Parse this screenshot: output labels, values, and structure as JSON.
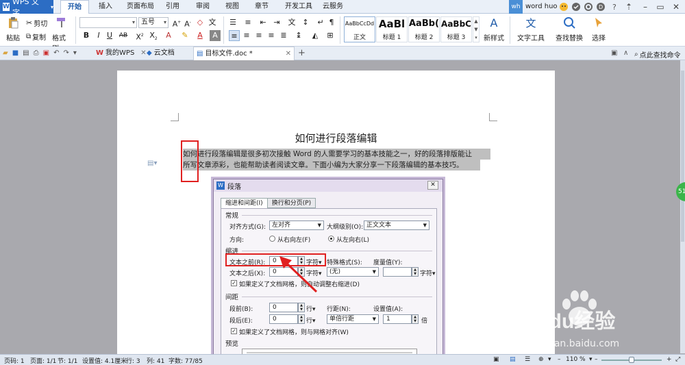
{
  "titlebar": {
    "app_button": "WPS 文字",
    "tabs": [
      "开始",
      "插入",
      "页面布局",
      "引用",
      "审阅",
      "视图",
      "章节",
      "开发工具",
      "云服务"
    ],
    "active_tab": "开始",
    "user_initials": "wh",
    "username": "word huo"
  },
  "ribbon": {
    "paste": "粘贴",
    "cut": "剪切",
    "copy": "复制",
    "format_painter": "格式刷",
    "font_size": "五号",
    "styles": [
      {
        "sample": "AaBbCcDd",
        "name": "正文"
      },
      {
        "sample": "AaBl",
        "name": "标题 1"
      },
      {
        "sample": "AaBb(",
        "name": "标题 2"
      },
      {
        "sample": "AaBbC",
        "name": "标题 3"
      }
    ],
    "new_style": "新样式",
    "text_tools": "文字工具",
    "find_replace": "查找替换",
    "select": "选择"
  },
  "tabs_bar": {
    "tab_mywps": "我的WPS",
    "tab_cloud": "云文档",
    "tab_doc": "目标文件.doc *",
    "search_hint": "点此查找命令"
  },
  "document": {
    "title": "如何进行段落编辑",
    "line1": "如何进行段落编辑是很多初次接触 Word 的人需要学习的基本技能之一，好的段落排版能让",
    "line2": "所写文章添彩，也能帮助读者阅读文章。下面小编为大家分享一下段落编辑的基本技巧。"
  },
  "dialog": {
    "title": "段落",
    "tab_indent": "缩进和间距(I)",
    "tab_breaks": "换行和分页(P)",
    "general": "常规",
    "align_label": "对齐方式(G):",
    "align_value": "左对齐",
    "outline_label": "大纲级别(O):",
    "outline_value": "正文文本",
    "direction_label": "方向:",
    "rtl": "从右向左(F)",
    "ltr": "从左向右(L)",
    "indent": "缩进",
    "before_text_label": "文本之前(R):",
    "before_text_value": "0",
    "after_text_label": "文本之后(X):",
    "after_text_value": "0",
    "unit_char": "字符▾",
    "special_label": "特殊格式(S):",
    "special_value": "(无)",
    "measure_label": "度量值(Y):",
    "auto_indent_check": "如果定义了文档网格，则自动调整右缩进(D)",
    "spacing": "间距",
    "before_para_label": "段前(B):",
    "before_para_value": "0",
    "after_para_label": "段后(E):",
    "after_para_value": "0",
    "unit_line": "行▾",
    "line_spacing_label": "行距(N):",
    "line_spacing_value": "单倍行距",
    "set_value_label": "设置值(A):",
    "set_value": "1",
    "times": "倍",
    "grid_check": "如果定义了文档网格，则与网格对齐(W)",
    "preview": "预览"
  },
  "status": {
    "page_no": "页码: 1",
    "pages": "页面: 1/1",
    "section": "节: 1/1",
    "set_value": "设置值: 4.1厘米",
    "row": "行: 3",
    "col": "列: 41",
    "words": "字数: 77/85",
    "zoom": "110 %"
  },
  "watermark": {
    "brand": "Baidu经验",
    "url": "jingyan.baidu.com"
  },
  "side_badge": "51",
  "colors": {
    "accent": "#2c6dc4",
    "highlight_box": "#e02020",
    "selection": "#bfbfbf"
  }
}
